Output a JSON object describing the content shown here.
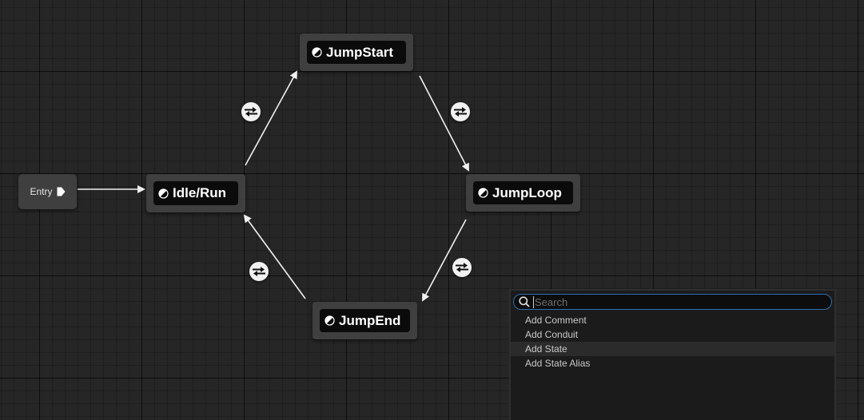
{
  "graph": {
    "entry_label": "Entry",
    "states": [
      {
        "id": "idle_run",
        "name": "Idle/Run"
      },
      {
        "id": "jump_start",
        "name": "JumpStart"
      },
      {
        "id": "jump_loop",
        "name": "JumpLoop"
      },
      {
        "id": "jump_end",
        "name": "JumpEnd"
      }
    ],
    "transitions": [
      {
        "from": "Idle/Run",
        "to": "JumpStart"
      },
      {
        "from": "JumpStart",
        "to": "JumpLoop"
      },
      {
        "from": "JumpLoop",
        "to": "JumpEnd"
      },
      {
        "from": "JumpEnd",
        "to": "Idle/Run"
      }
    ],
    "colors": {
      "wire": "#f0f0f0",
      "node": "#3f3f3f",
      "node_inner": "#0b0b0b"
    }
  },
  "context_menu": {
    "search_placeholder": "Search",
    "search_value": "",
    "items": [
      {
        "label": "Add Comment"
      },
      {
        "label": "Add Conduit"
      },
      {
        "label": "Add State"
      },
      {
        "label": "Add State Alias"
      }
    ],
    "highlighted_index": 2,
    "accent_color": "#2e6fb0"
  },
  "icons": {
    "state": "state-half-circle-icon",
    "transition": "transition-arrows-icon",
    "entry": "entry-arrow-icon",
    "search": "search-icon"
  }
}
